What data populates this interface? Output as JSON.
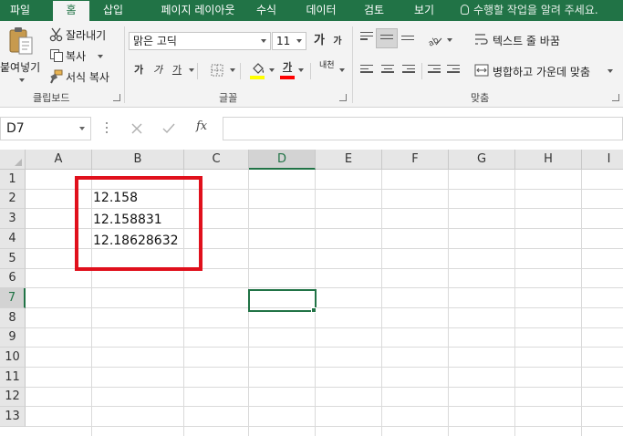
{
  "tabs": [
    "파일",
    "홈",
    "삽입",
    "페이지 레이아웃",
    "수식",
    "데이터",
    "검토",
    "보기"
  ],
  "tell_me": "수행할 작업을 알려 주세요.",
  "clipboard": {
    "paste": "붙여넣기",
    "cut": "잘라내기",
    "copy": "복사",
    "format_painter": "서식 복사",
    "group": "클립보드"
  },
  "font": {
    "name": "맑은 고딕",
    "size": "11",
    "grow": "가",
    "shrink": "가",
    "bold": "가",
    "italic": "가",
    "underline": "가",
    "font_color": "가",
    "phonetic": "내천",
    "group": "글꼴",
    "fill_color": "#ffff00",
    "text_color": "#ff0000"
  },
  "alignment": {
    "wrap_text": "텍스트 줄 바꿈",
    "merge_center": "병합하고 가운데 맞춤",
    "group": "맞춤"
  },
  "formula_bar": {
    "name_box": "D7",
    "fx": "fx",
    "value": ""
  },
  "columns": [
    "A",
    "B",
    "C",
    "D",
    "E",
    "F",
    "G",
    "H",
    "I"
  ],
  "selected_column": "D",
  "rows": [
    "1",
    "2",
    "3",
    "4",
    "5",
    "6",
    "7",
    "8",
    "9",
    "10",
    "11",
    "12",
    "13"
  ],
  "selected_row": "7",
  "cells": {
    "B2": "12.158",
    "B3": "12.158831",
    "B4": "12.18628632"
  },
  "accent_color": "#217346",
  "highlight_color": "#e0101c"
}
